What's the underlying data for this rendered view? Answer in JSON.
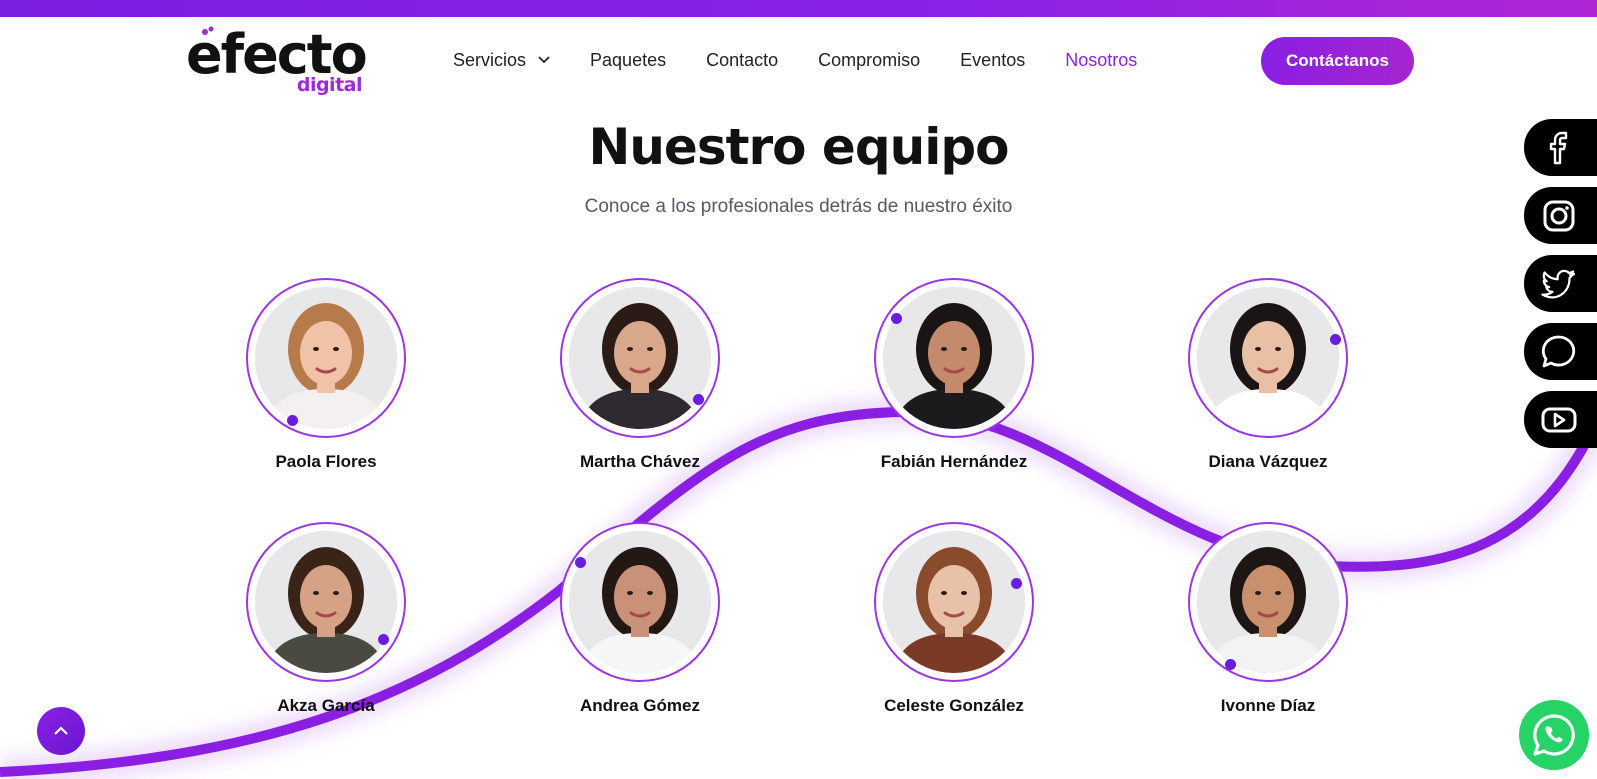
{
  "header": {
    "logo_main": "efecto",
    "logo_sub": "digital",
    "nav": [
      {
        "label": "Servicios",
        "has_dropdown": true,
        "active": false
      },
      {
        "label": "Paquetes",
        "active": false
      },
      {
        "label": "Contacto",
        "active": false
      },
      {
        "label": "Compromiso",
        "active": false
      },
      {
        "label": "Eventos",
        "active": false
      },
      {
        "label": "Nosotros",
        "active": true
      }
    ],
    "cta_label": "Contáctanos"
  },
  "section": {
    "title": "Nuestro equipo",
    "subtitle": "Conoce a los profesionales detrás de nuestro éxito"
  },
  "team": [
    {
      "name": "Paola Flores"
    },
    {
      "name": "Martha Chávez"
    },
    {
      "name": "Fabián Hernández"
    },
    {
      "name": "Diana Vázquez"
    },
    {
      "name": "Akza García"
    },
    {
      "name": "Andrea Gómez"
    },
    {
      "name": "Celeste González"
    },
    {
      "name": "Ivonne Díaz"
    }
  ],
  "social": [
    "facebook-icon",
    "instagram-icon",
    "twitter-icon",
    "chat-icon",
    "youtube-icon"
  ],
  "colors": {
    "accent": "#8a24d8",
    "wave": "#8a1fe3",
    "dot": "#6a1de0",
    "whatsapp": "#25d366"
  }
}
